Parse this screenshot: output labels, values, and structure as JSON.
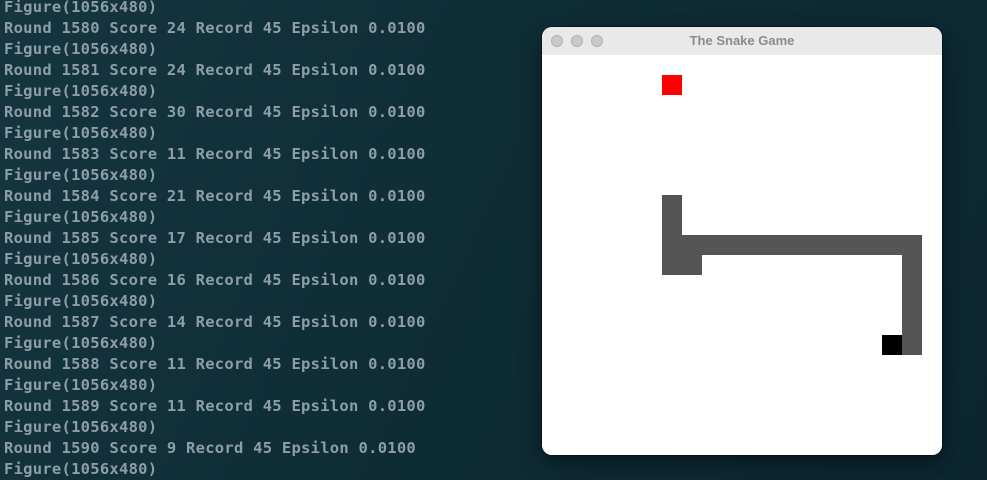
{
  "terminal": {
    "lines": [
      "Figure(1056x480)",
      "Round 1580 Score 24 Record 45 Epsilon 0.0100",
      "Figure(1056x480)",
      "Round 1581 Score 24 Record 45 Epsilon 0.0100",
      "Figure(1056x480)",
      "Round 1582 Score 30 Record 45 Epsilon 0.0100",
      "Figure(1056x480)",
      "Round 1583 Score 11 Record 45 Epsilon 0.0100",
      "Figure(1056x480)",
      "Round 1584 Score 21 Record 45 Epsilon 0.0100",
      "Figure(1056x480)",
      "Round 1585 Score 17 Record 45 Epsilon 0.0100",
      "Figure(1056x480)",
      "Round 1586 Score 16 Record 45 Epsilon 0.0100",
      "Figure(1056x480)",
      "Round 1587 Score 14 Record 45 Epsilon 0.0100",
      "Figure(1056x480)",
      "Round 1588 Score 11 Record 45 Epsilon 0.0100",
      "Figure(1056x480)",
      "Round 1589 Score 11 Record 45 Epsilon 0.0100",
      "Figure(1056x480)",
      "Round 1590 Score 9 Record 45 Epsilon 0.0100",
      "Figure(1056x480)"
    ],
    "text_color": "#8e9ea6",
    "background_color": "#0e2a33"
  },
  "window": {
    "title": "The Snake Game",
    "controls": [
      "close",
      "minimize",
      "zoom"
    ]
  },
  "game": {
    "grid_cells": 20,
    "food": {
      "col": 6,
      "row": 1
    },
    "head": {
      "col": 17,
      "row": 14
    },
    "body": [
      {
        "col": 18,
        "row": 14
      },
      {
        "col": 18,
        "row": 13
      },
      {
        "col": 18,
        "row": 12
      },
      {
        "col": 18,
        "row": 11
      },
      {
        "col": 18,
        "row": 10
      },
      {
        "col": 18,
        "row": 9
      },
      {
        "col": 17,
        "row": 9
      },
      {
        "col": 16,
        "row": 9
      },
      {
        "col": 15,
        "row": 9
      },
      {
        "col": 14,
        "row": 9
      },
      {
        "col": 13,
        "row": 9
      },
      {
        "col": 12,
        "row": 9
      },
      {
        "col": 11,
        "row": 9
      },
      {
        "col": 10,
        "row": 9
      },
      {
        "col": 9,
        "row": 9
      },
      {
        "col": 8,
        "row": 9
      },
      {
        "col": 7,
        "row": 9
      },
      {
        "col": 6,
        "row": 9
      },
      {
        "col": 6,
        "row": 8
      },
      {
        "col": 6,
        "row": 7
      },
      {
        "col": 6,
        "row": 10
      },
      {
        "col": 7,
        "row": 10
      }
    ],
    "colors": {
      "food": "#ff0000",
      "head": "#000000",
      "body": "#555555",
      "background": "#ffffff"
    }
  }
}
